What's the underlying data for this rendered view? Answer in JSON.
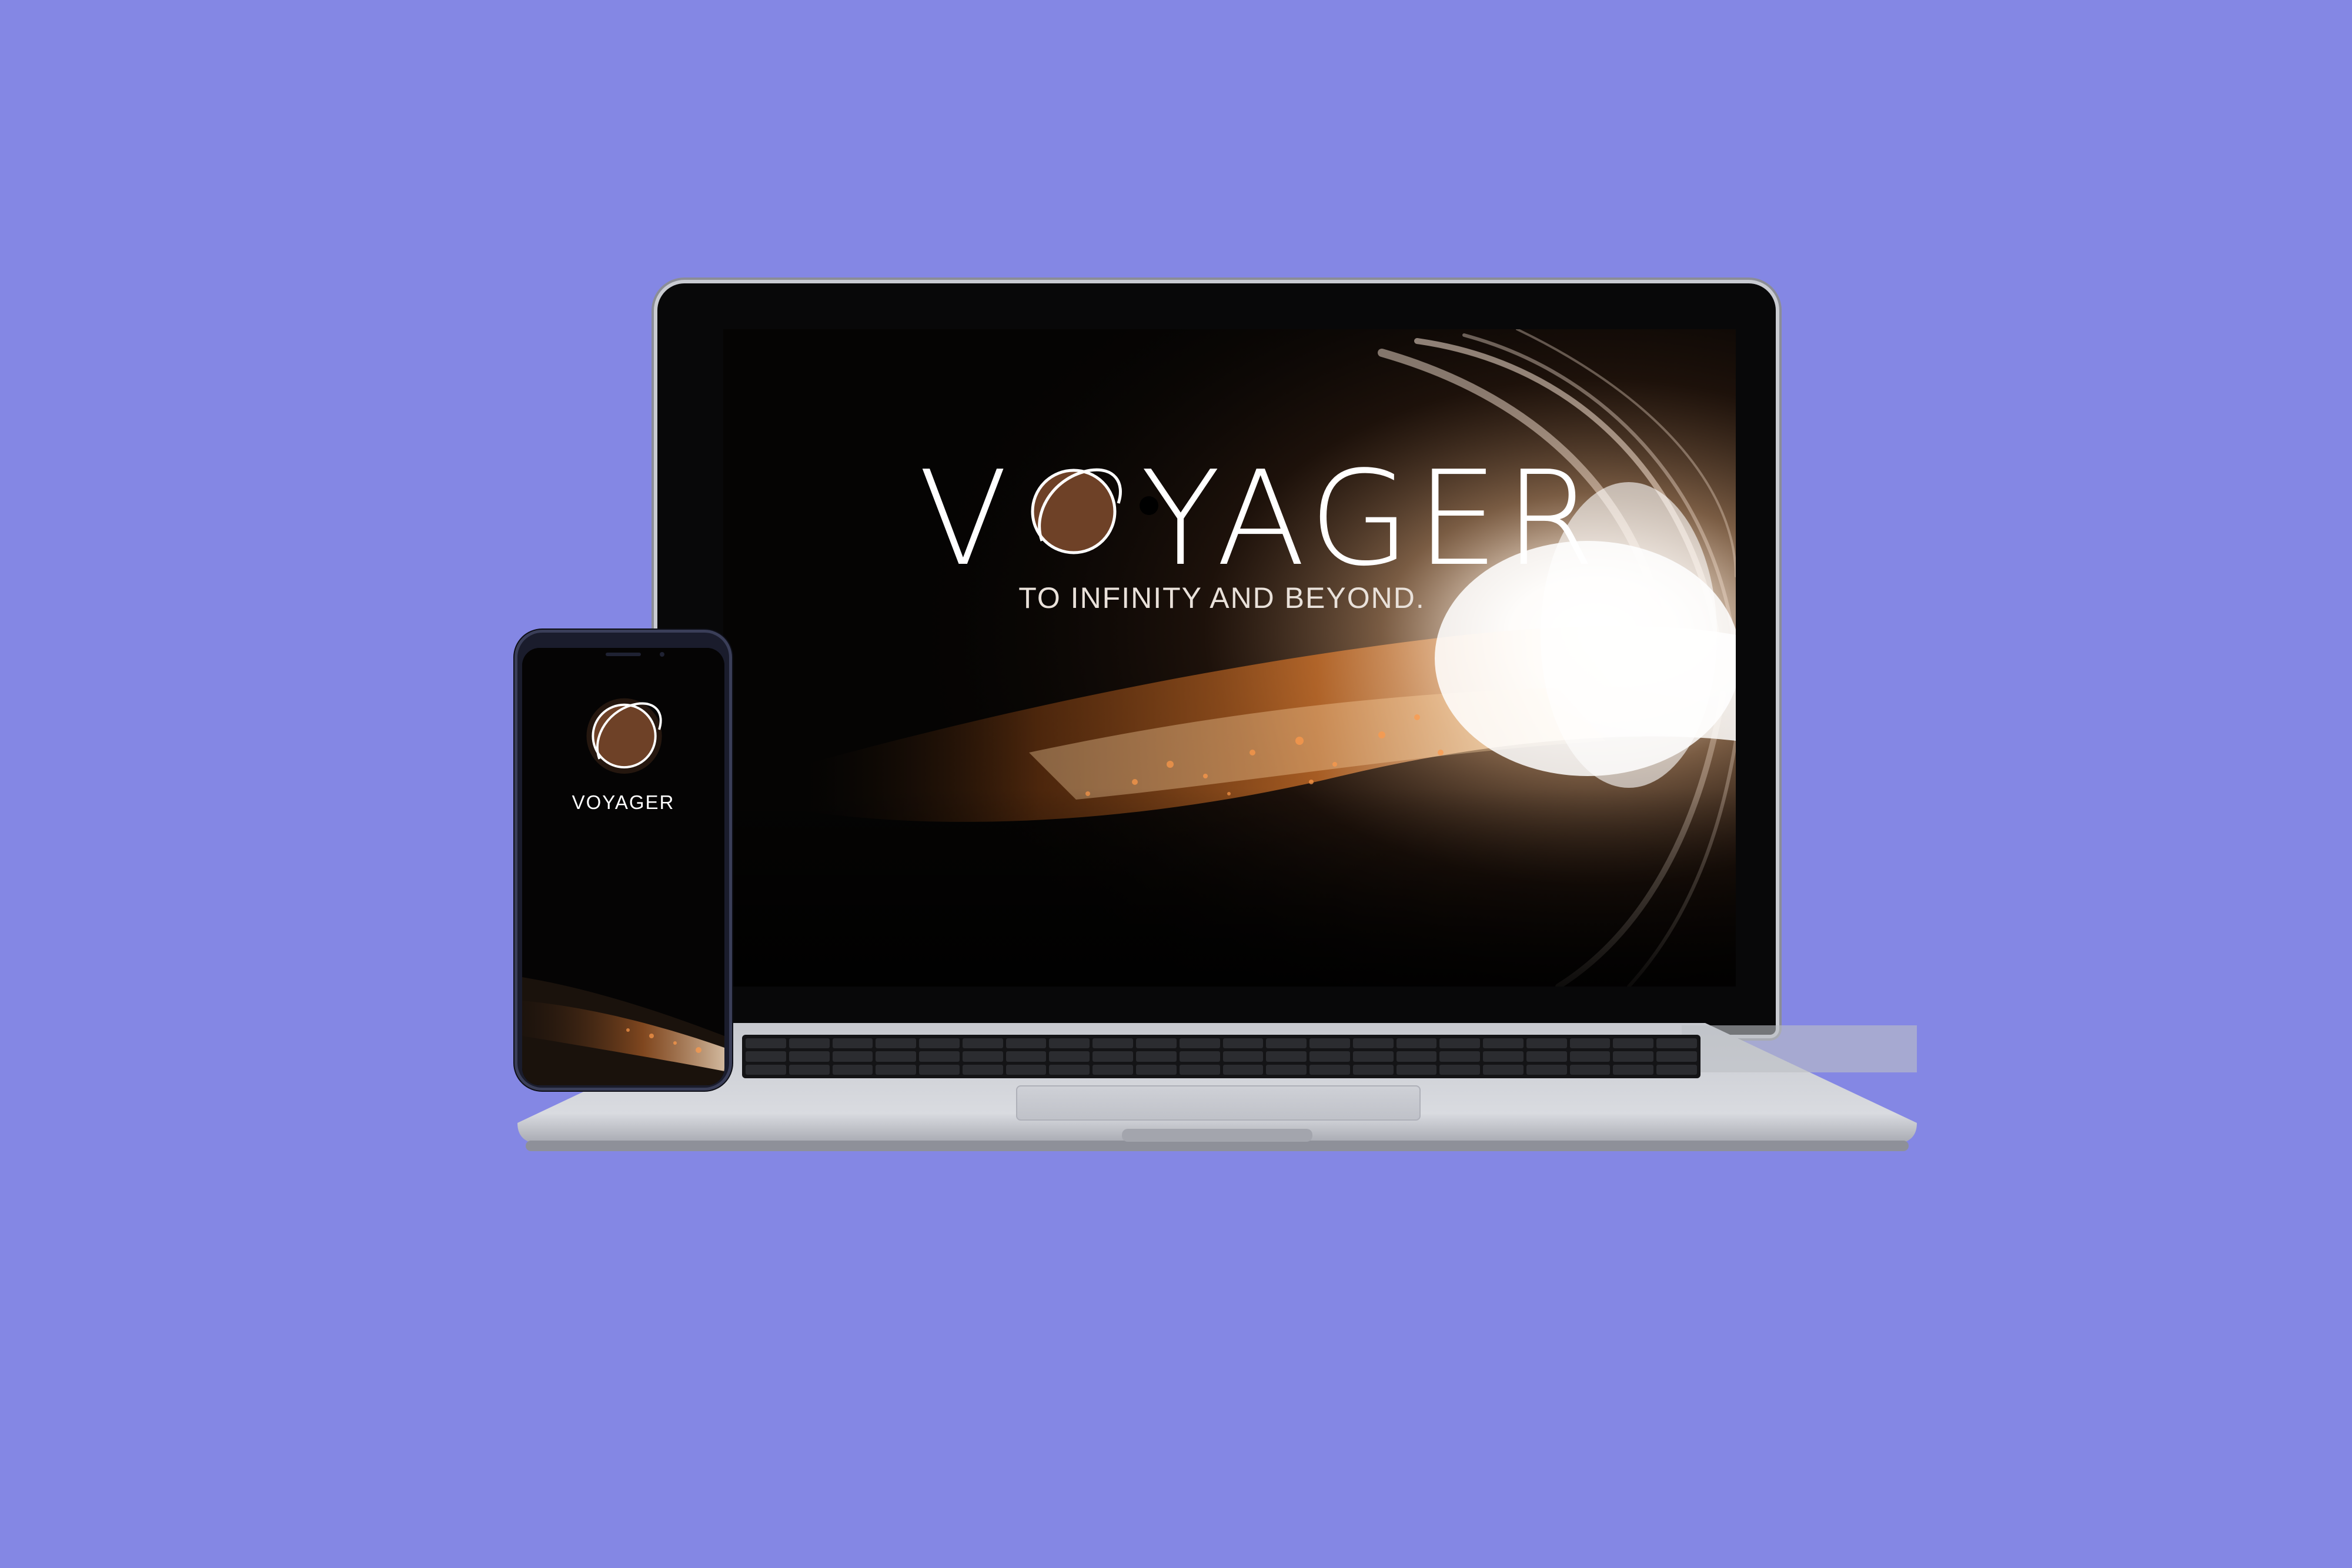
{
  "colors": {
    "background": "#8487e4",
    "laptop_bezel": "#080809",
    "laptop_body": "#c9cbd2",
    "accretion_glow": "#f3c59b",
    "planet_brown": "#6e4127"
  },
  "laptop": {
    "title_left": "V",
    "title_right": "YAGER",
    "tagline": "TO INFINITY AND BEYOND."
  },
  "phone": {
    "title": "VOYAGER"
  },
  "icons": {
    "logo": "planet-orbit-icon"
  }
}
